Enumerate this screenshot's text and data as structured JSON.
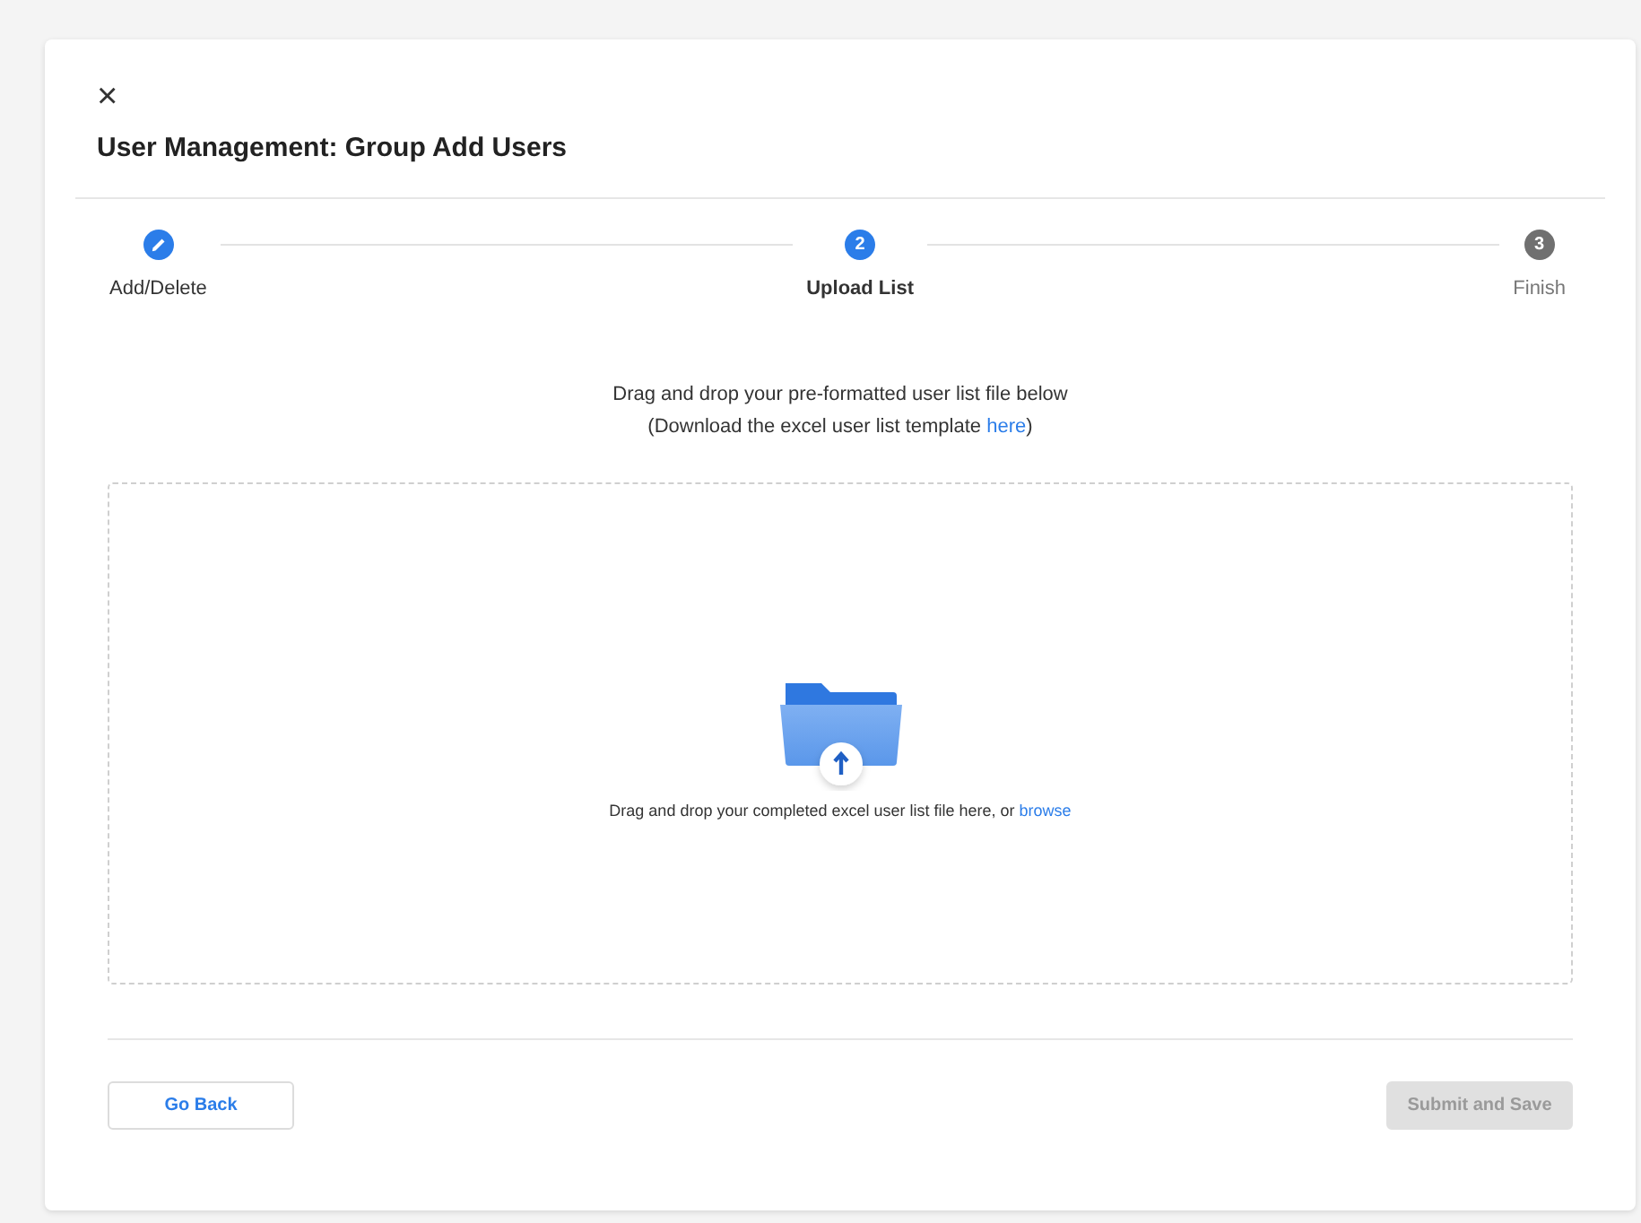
{
  "dialog": {
    "close": "×",
    "title": "User Management: Group Add Users"
  },
  "steps": [
    {
      "label": "Add/Delete",
      "kind": "done"
    },
    {
      "label": "Upload List",
      "number": "2",
      "kind": "active"
    },
    {
      "label": "Finish",
      "number": "3",
      "kind": "pending"
    }
  ],
  "instructions": {
    "line_1": "Drag and drop your pre-formatted user list file below",
    "line_2_before": "(Download the excel user list template ",
    "line_2_link": "here",
    "line_2_after": ")"
  },
  "dropzone": {
    "text": "Drag and drop your completed excel user list file here, or ",
    "link": "browse"
  },
  "buttons": [
    {
      "label": "Go Back",
      "disabled": false
    },
    {
      "label": "Submit and Save",
      "disabled": true
    }
  ]
}
